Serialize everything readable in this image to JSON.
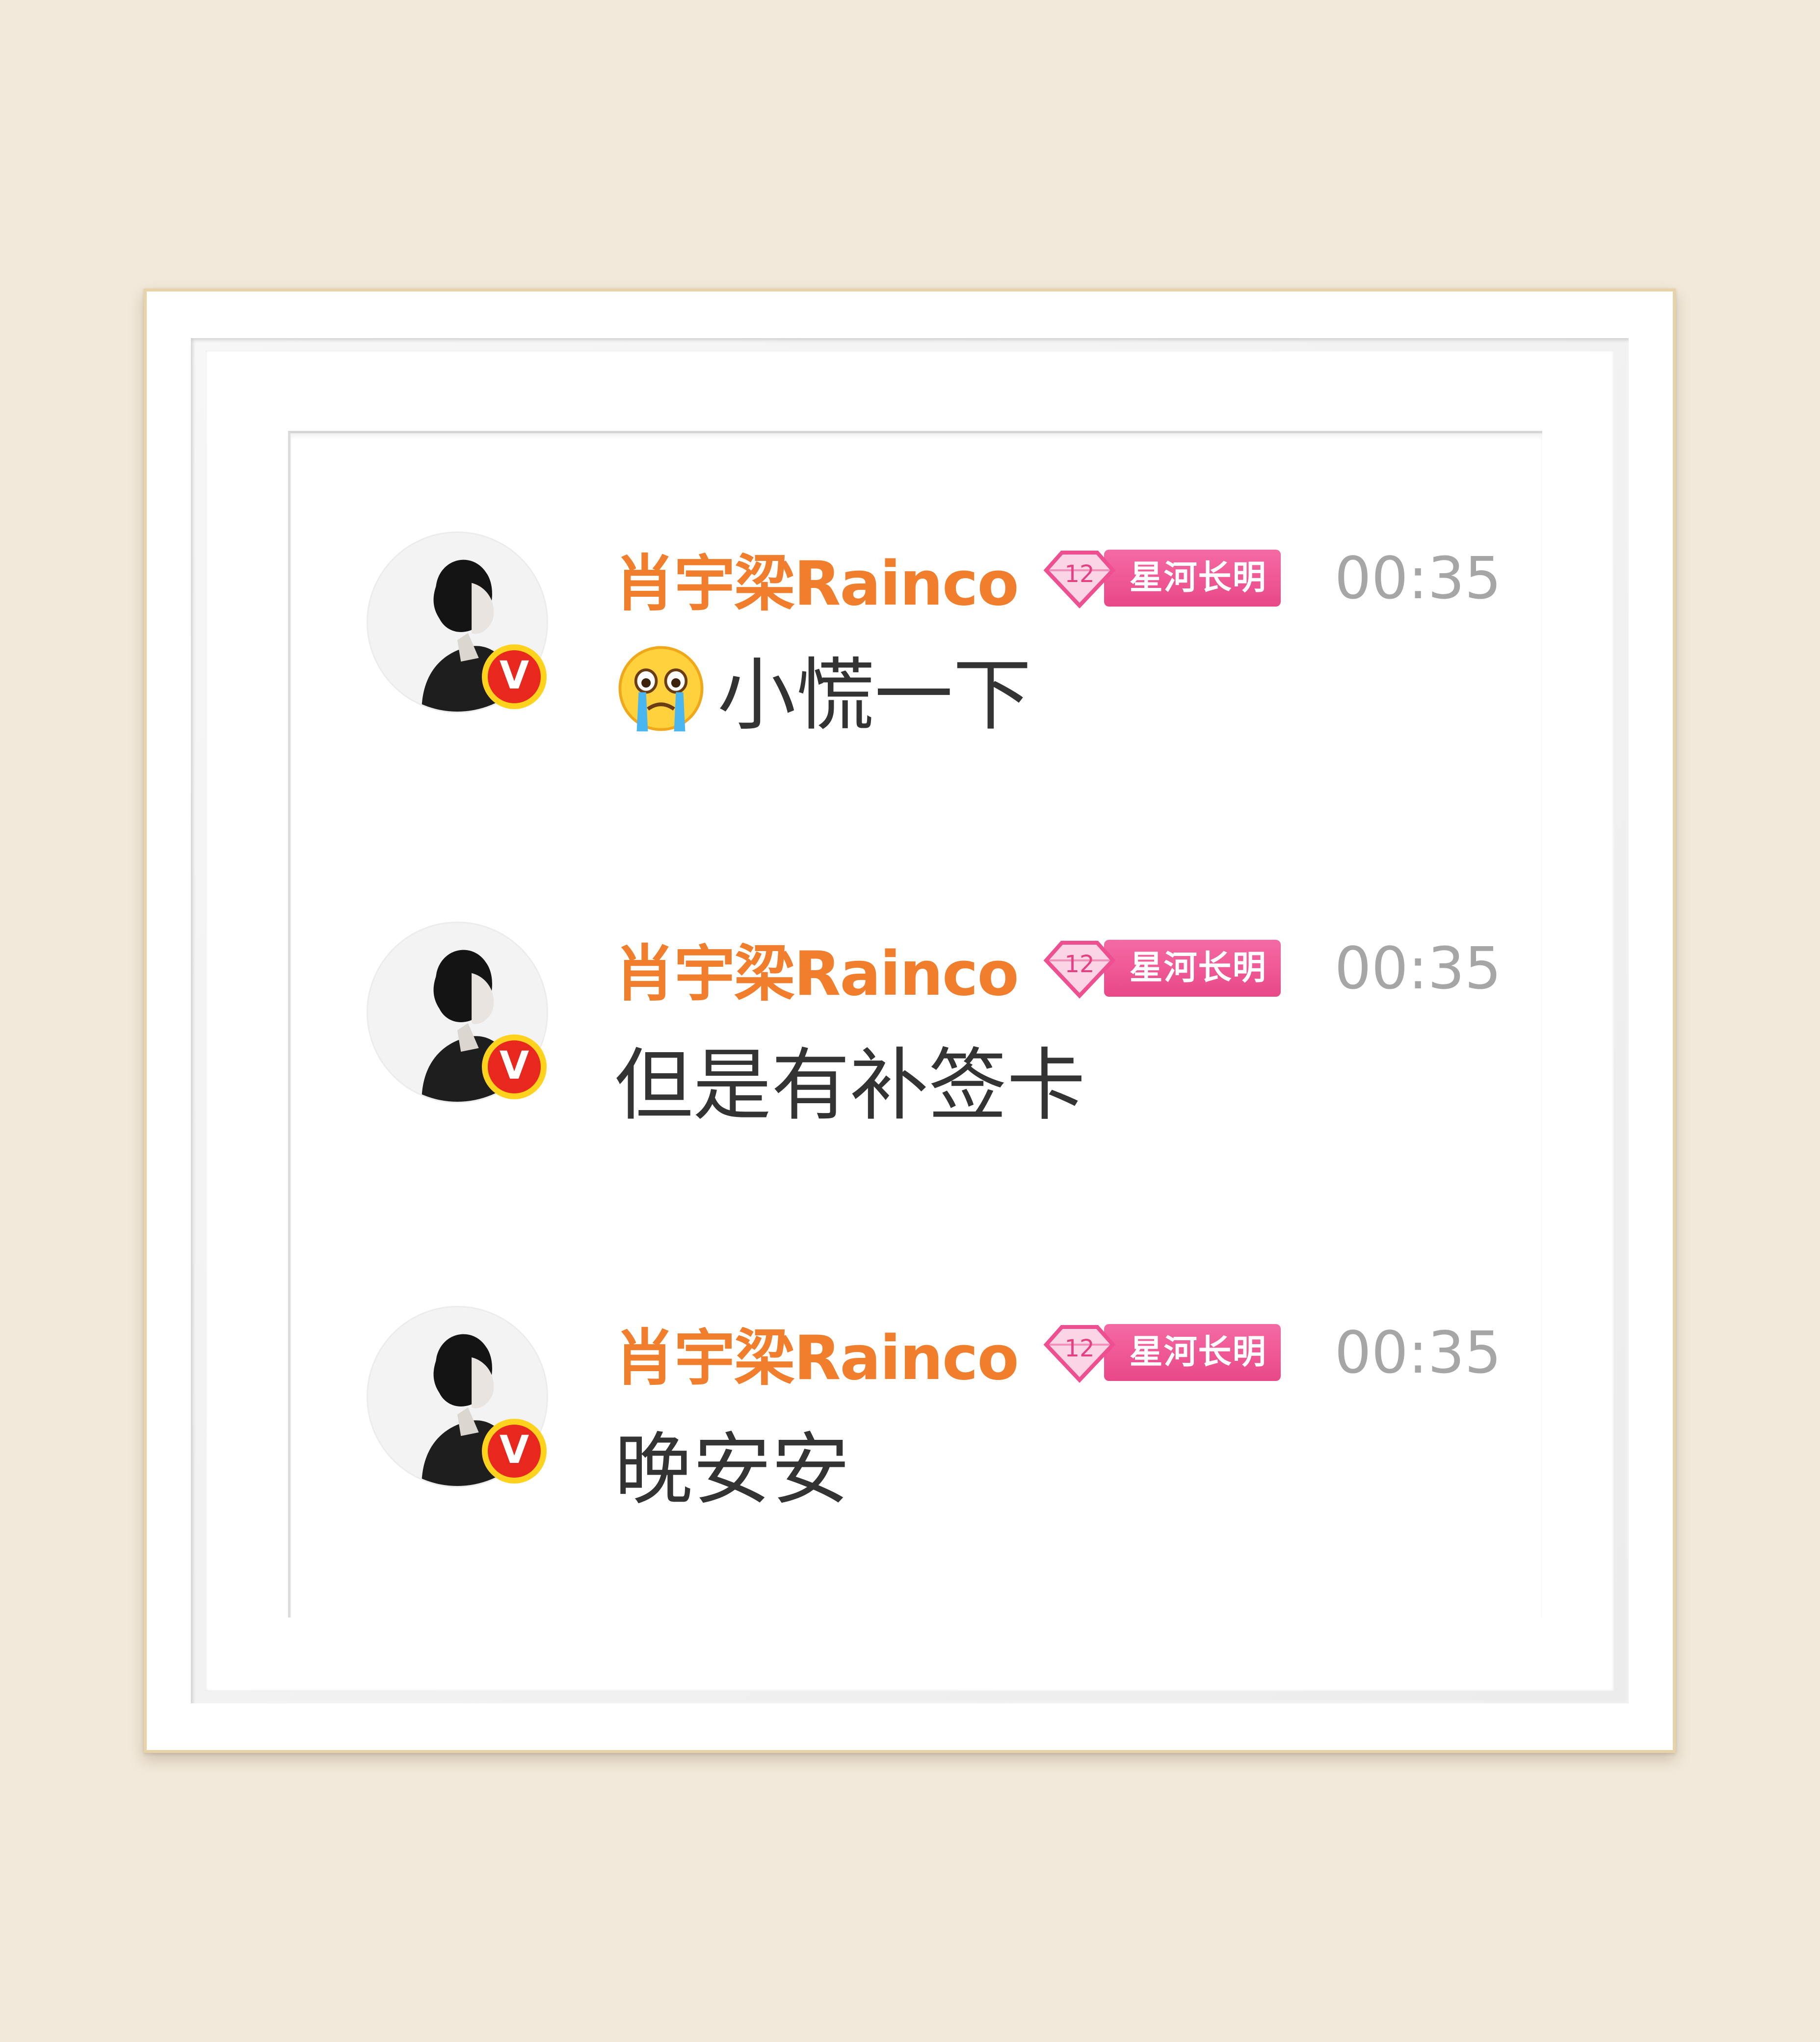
{
  "colors": {
    "background": "#f2e9da",
    "username": "#f07e2c",
    "badge_pink": "#e94887",
    "timestamp": "#a6a6a6",
    "message": "#333333",
    "verified_red": "#e8281e",
    "verified_ring": "#ffd21e"
  },
  "comments": [
    {
      "username": "肖宇梁Rainco",
      "fan_level": "12",
      "fan_title": "星河长明",
      "time": "00:35",
      "emoji": "crying-face-icon",
      "text": "小慌一下",
      "verified_mark": "V"
    },
    {
      "username": "肖宇梁Rainco",
      "fan_level": "12",
      "fan_title": "星河长明",
      "time": "00:35",
      "text": "但是有补签卡",
      "verified_mark": "V"
    },
    {
      "username": "肖宇梁Rainco",
      "fan_level": "12",
      "fan_title": "星河长明",
      "time": "00:35",
      "text": "晚安安",
      "verified_mark": "V"
    }
  ]
}
